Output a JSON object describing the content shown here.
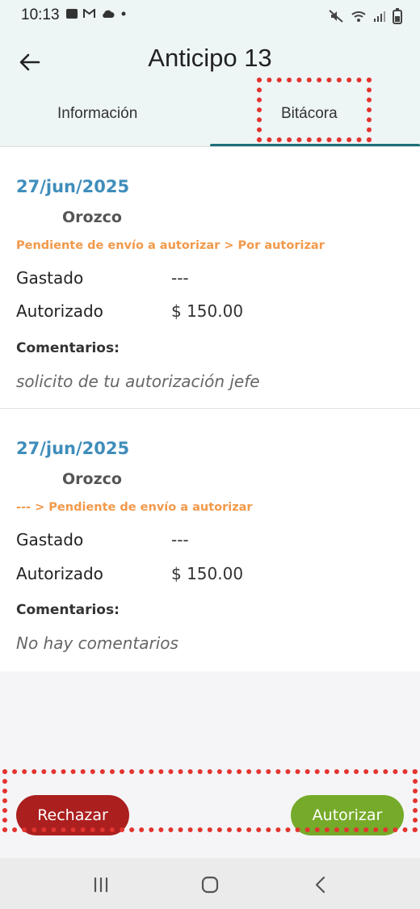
{
  "status_bar": {
    "time": "10:13"
  },
  "header": {
    "title": "Anticipo 13"
  },
  "tabs": [
    {
      "label": "Información",
      "active": false
    },
    {
      "label": "Bitácora",
      "active": true
    }
  ],
  "entries": [
    {
      "date": "27/jun/2025",
      "user": "Orozco",
      "status": "Pendiente de envío a autorizar > Por autorizar",
      "spent_label": "Gastado",
      "spent_value": "---",
      "authorized_label": "Autorizado",
      "authorized_value": "$ 150.00",
      "comments_label": "Comentarios:",
      "comment": "solicito de tu autorización jefe"
    },
    {
      "date": "27/jun/2025",
      "user": "Orozco",
      "status": "--- > Pendiente de envío a autorizar",
      "spent_label": "Gastado",
      "spent_value": "---",
      "authorized_label": "Autorizado",
      "authorized_value": "$ 150.00",
      "comments_label": "Comentarios:",
      "comment": "No hay comentarios"
    }
  ],
  "actions": {
    "reject_label": "Rechazar",
    "authorize_label": "Autorizar"
  },
  "colors": {
    "accent": "#1e6f78",
    "date": "#3f8dbb",
    "status": "#f2994a",
    "reject": "#ab1f1f",
    "authorize": "#76aa2a",
    "highlight": "#e3342f"
  },
  "icons": {
    "status_left": [
      "image-icon",
      "gmail-icon",
      "cloud-icon",
      "dot-icon"
    ],
    "status_right": [
      "mute-icon",
      "wifi-icon",
      "signal-icon",
      "battery-icon"
    ],
    "nav": [
      "recent-apps-icon",
      "home-icon",
      "back-nav-icon"
    ]
  }
}
